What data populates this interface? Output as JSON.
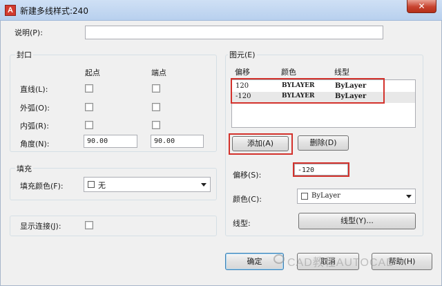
{
  "window": {
    "title": "新建多线样式:240",
    "close_label": "✕",
    "app_icon": "A"
  },
  "description": {
    "label": "说明(P):",
    "value": ""
  },
  "caps": {
    "group_label": "封口",
    "col_start": "起点",
    "col_end": "端点",
    "rows": [
      {
        "label": "直线(L):",
        "start": false,
        "end": false
      },
      {
        "label": "外弧(O):",
        "start": false,
        "end": false
      },
      {
        "label": "内弧(R):",
        "start": false,
        "end": false
      }
    ],
    "angle_label": "角度(N):",
    "angle_start": "90.00",
    "angle_end": "90.00"
  },
  "fill": {
    "group_label": "填充",
    "color_label": "填充颜色(F):",
    "color_value": "无"
  },
  "display_joints": {
    "label": "显示连接(J):",
    "checked": false
  },
  "elements": {
    "group_label": "图元(E)",
    "headers": {
      "offset": "偏移",
      "color": "颜色",
      "linetype": "线型"
    },
    "rows": [
      {
        "offset": "120",
        "color": "BYLAYER",
        "linetype": "ByLayer"
      },
      {
        "offset": "-120",
        "color": "BYLAYER",
        "linetype": "ByLayer"
      }
    ],
    "add_label": "添加(A)",
    "delete_label": "删除(D)",
    "offset_label": "偏移(S):",
    "offset_value": "-120",
    "color_label": "颜色(C):",
    "color_value": "ByLayer",
    "linetype_label": "线型:",
    "linetype_button": "线型(Y)..."
  },
  "footer": {
    "ok_label": "确定",
    "cancel_label": "取消",
    "help_label": "帮助(H)"
  },
  "watermark": "CAD教程AUTOCAD",
  "colors": {
    "highlight_box": "#d3312b",
    "selected_row": "#e8e8e8"
  }
}
